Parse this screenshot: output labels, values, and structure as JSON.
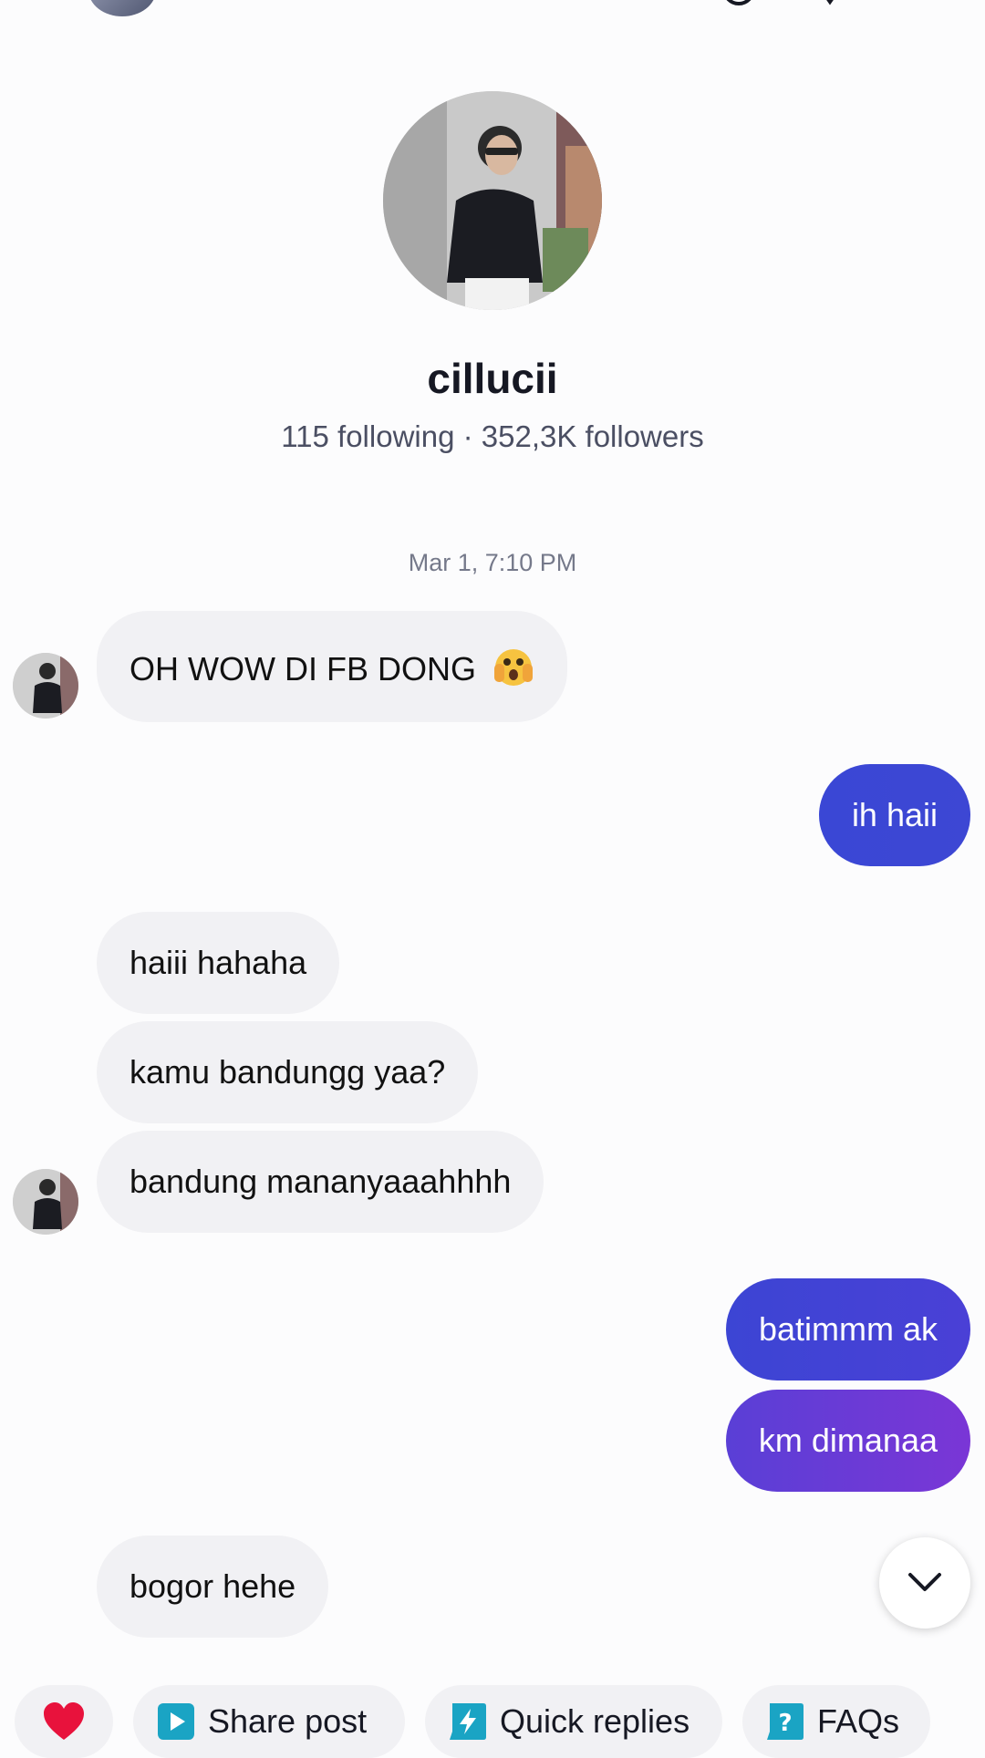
{
  "profile": {
    "name": "cillucii",
    "stats": "115 following · 352,3K followers"
  },
  "chat": {
    "timestamp": "Mar 1, 7:10 PM",
    "messages": [
      {
        "side": "in",
        "text": "OH WOW DI FB DONG"
      },
      {
        "side": "out",
        "text": "ih haii"
      },
      {
        "side": "in",
        "text": "haiii hahaha"
      },
      {
        "side": "in",
        "text": "kamu bandungg yaa?"
      },
      {
        "side": "in",
        "text": "bandung mananyaaahhhh"
      },
      {
        "side": "out",
        "text": "batimmm ak"
      },
      {
        "side": "out",
        "text": "km dimanaa"
      },
      {
        "side": "in",
        "text": "bogor hehe"
      }
    ]
  },
  "quick_actions": [
    {
      "label": "",
      "icon": "heart-icon"
    },
    {
      "label": "Share post",
      "icon": "play-icon"
    },
    {
      "label": "Quick replies",
      "icon": "lightning-icon"
    },
    {
      "label": "FAQs",
      "icon": "question-icon"
    }
  ],
  "colors": {
    "incoming_bubble": "#f1f1f4",
    "outgoing_start": "#3a47d5",
    "outgoing_end": "#7a36d6",
    "heart": "#e8123c",
    "chip_icon": "#1aa4c4"
  }
}
